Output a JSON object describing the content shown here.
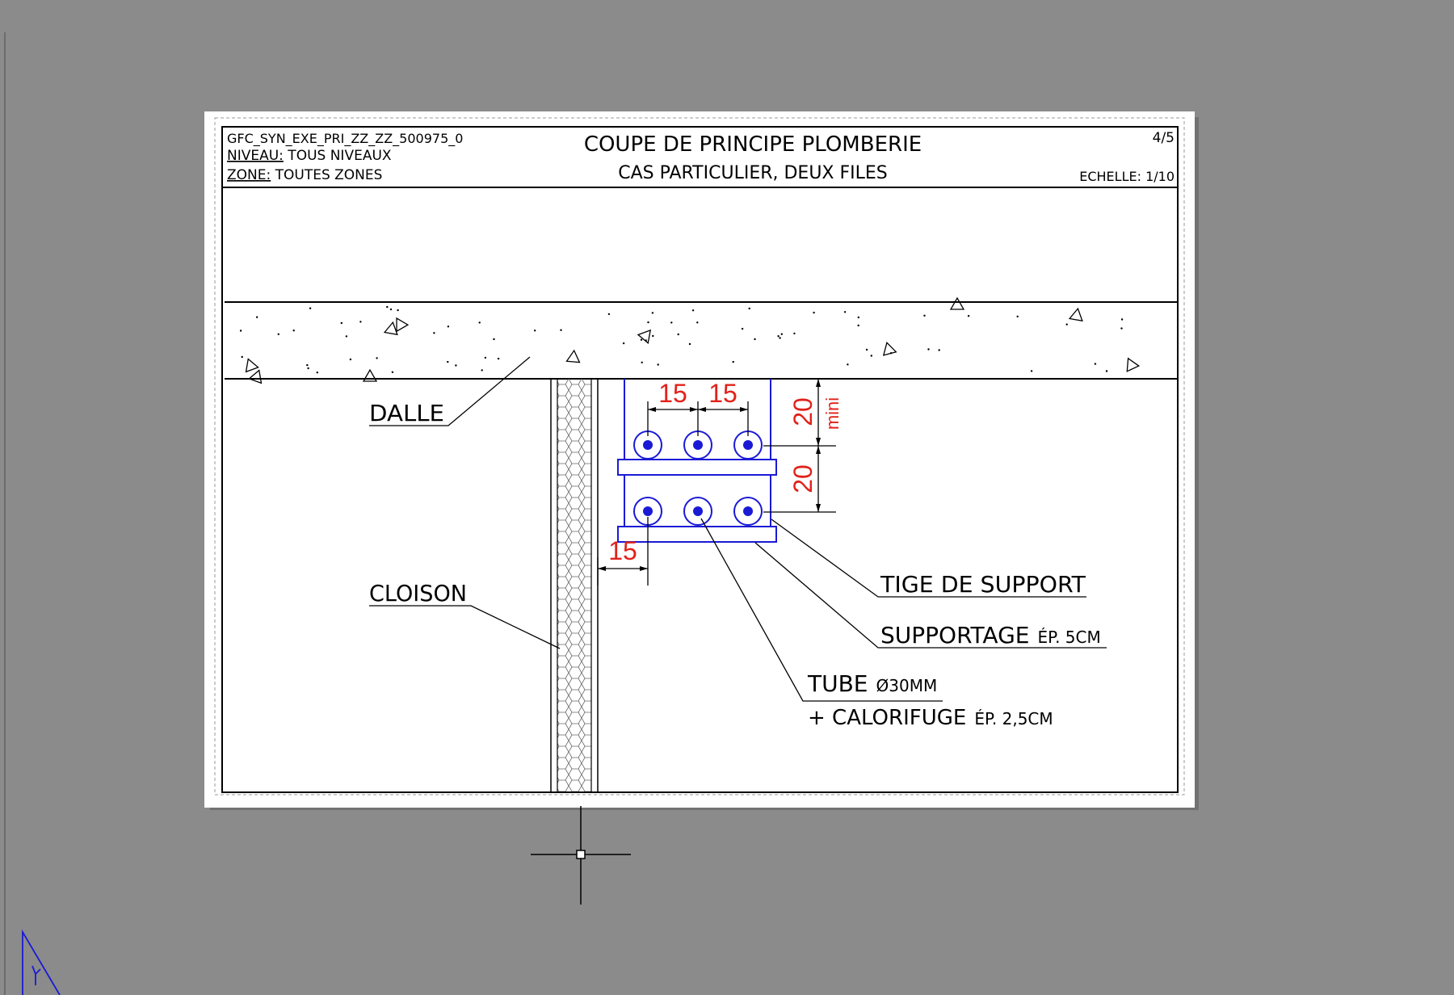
{
  "sheet": {
    "reference": "GFC_SYN_EXE_PRI_ZZ_ZZ_500975_0",
    "niveau_label": "NIVEAU:",
    "niveau_value": " TOUS NIVEAUX",
    "zone_label": "ZONE:",
    "zone_value": " TOUTES ZONES",
    "title": "COUPE DE PRINCIPE PLOMBERIE",
    "subtitle": "CAS PARTICULIER, DEUX FILES",
    "page": "4/5",
    "scale": "ECHELLE: 1/10"
  },
  "labels": {
    "dalle": "DALLE",
    "cloison": "CLOISON",
    "tige": "TIGE DE SUPPORT",
    "supportage": "SUPPORTAGE",
    "supportage_detail": "ÉP. 5CM",
    "tube": "TUBE",
    "tube_detail": "Ø30MM",
    "calorifuge": "+ CALORIFUGE",
    "calorifuge_detail": "ÉP. 2,5CM"
  },
  "dimensions": {
    "spacing_a": "15",
    "spacing_b": "15",
    "wall_offset": "15",
    "top_clearance": "20",
    "top_clearance_note": "mini",
    "row_spacing": "20"
  },
  "colors": {
    "background": "#8b8b8b",
    "sheet": "#ffffff",
    "ink": "#000000",
    "pipe": "#1a1ad6",
    "dimension": "#e1221a"
  },
  "icons": {
    "crosshair": "cad-crosshair-cursor",
    "ucs": "ucs-axis-icon"
  }
}
